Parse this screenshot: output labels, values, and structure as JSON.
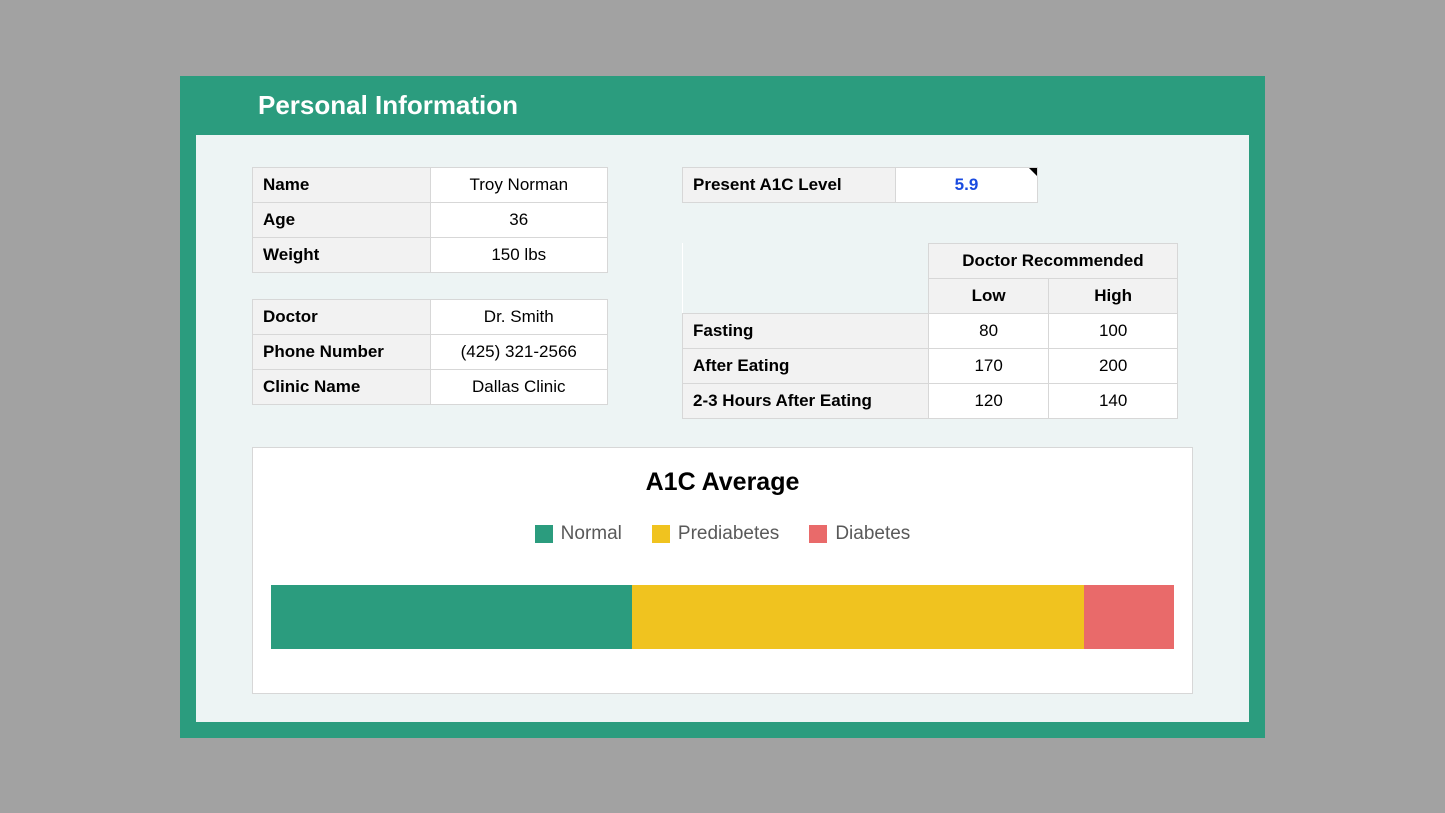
{
  "header": {
    "title": "Personal Information"
  },
  "personal": {
    "name_label": "Name",
    "name_value": "Troy Norman",
    "age_label": "Age",
    "age_value": "36",
    "weight_label": "Weight",
    "weight_value": "150 lbs"
  },
  "doctor": {
    "doctor_label": "Doctor",
    "doctor_value": "Dr. Smith",
    "phone_label": "Phone Number",
    "phone_value": "(425) 321-2566",
    "clinic_label": "Clinic Name",
    "clinic_value": "Dallas Clinic"
  },
  "a1c": {
    "label": "Present A1C Level",
    "value": "5.9"
  },
  "recommended": {
    "header": "Doctor Recommended",
    "low_label": "Low",
    "high_label": "High",
    "rows": [
      {
        "label": "Fasting",
        "low": "80",
        "high": "100"
      },
      {
        "label": "After Eating",
        "low": "170",
        "high": "200"
      },
      {
        "label": "2-3 Hours After Eating",
        "low": "120",
        "high": "140"
      }
    ]
  },
  "chart_data": {
    "type": "bar",
    "title": "A1C Average",
    "legend": [
      {
        "name": "Normal",
        "color": "#2b9c7e"
      },
      {
        "name": "Prediabetes",
        "color": "#f0c31f"
      },
      {
        "name": "Diabetes",
        "color": "#e96a6a"
      }
    ],
    "segments": [
      {
        "name": "Normal",
        "percent": 40,
        "color": "#2b9c7e"
      },
      {
        "name": "Prediabetes",
        "percent": 50,
        "color": "#f0c31f"
      },
      {
        "name": "Diabetes",
        "percent": 10,
        "color": "#e96a6a"
      }
    ]
  }
}
